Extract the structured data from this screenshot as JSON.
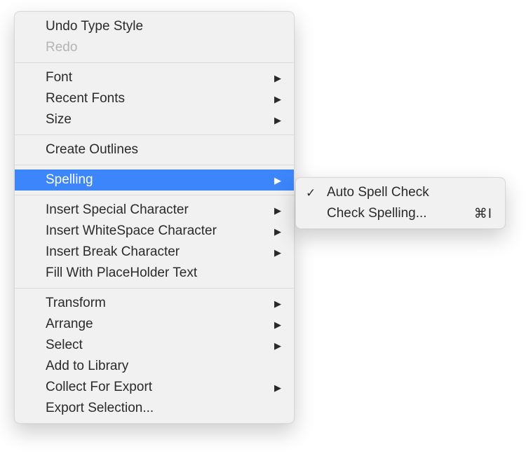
{
  "main_menu": {
    "undo": {
      "label": "Undo Type Style"
    },
    "redo": {
      "label": "Redo"
    },
    "font": {
      "label": "Font"
    },
    "recent_fonts": {
      "label": "Recent Fonts"
    },
    "size": {
      "label": "Size"
    },
    "create_outlines": {
      "label": "Create Outlines"
    },
    "spelling": {
      "label": "Spelling"
    },
    "insert_special": {
      "label": "Insert Special Character"
    },
    "insert_ws": {
      "label": "Insert WhiteSpace Character"
    },
    "insert_break": {
      "label": "Insert Break Character"
    },
    "fill_placeholder": {
      "label": "Fill With PlaceHolder Text"
    },
    "transform": {
      "label": "Transform"
    },
    "arrange": {
      "label": "Arrange"
    },
    "select": {
      "label": "Select"
    },
    "add_to_library": {
      "label": "Add to Library"
    },
    "collect_export": {
      "label": "Collect For Export"
    },
    "export_selection": {
      "label": "Export Selection..."
    }
  },
  "sub_menu": {
    "auto_spell": {
      "label": "Auto Spell Check",
      "checked": true
    },
    "check_spelling": {
      "label": "Check Spelling...",
      "shortcut": "⌘I"
    }
  }
}
